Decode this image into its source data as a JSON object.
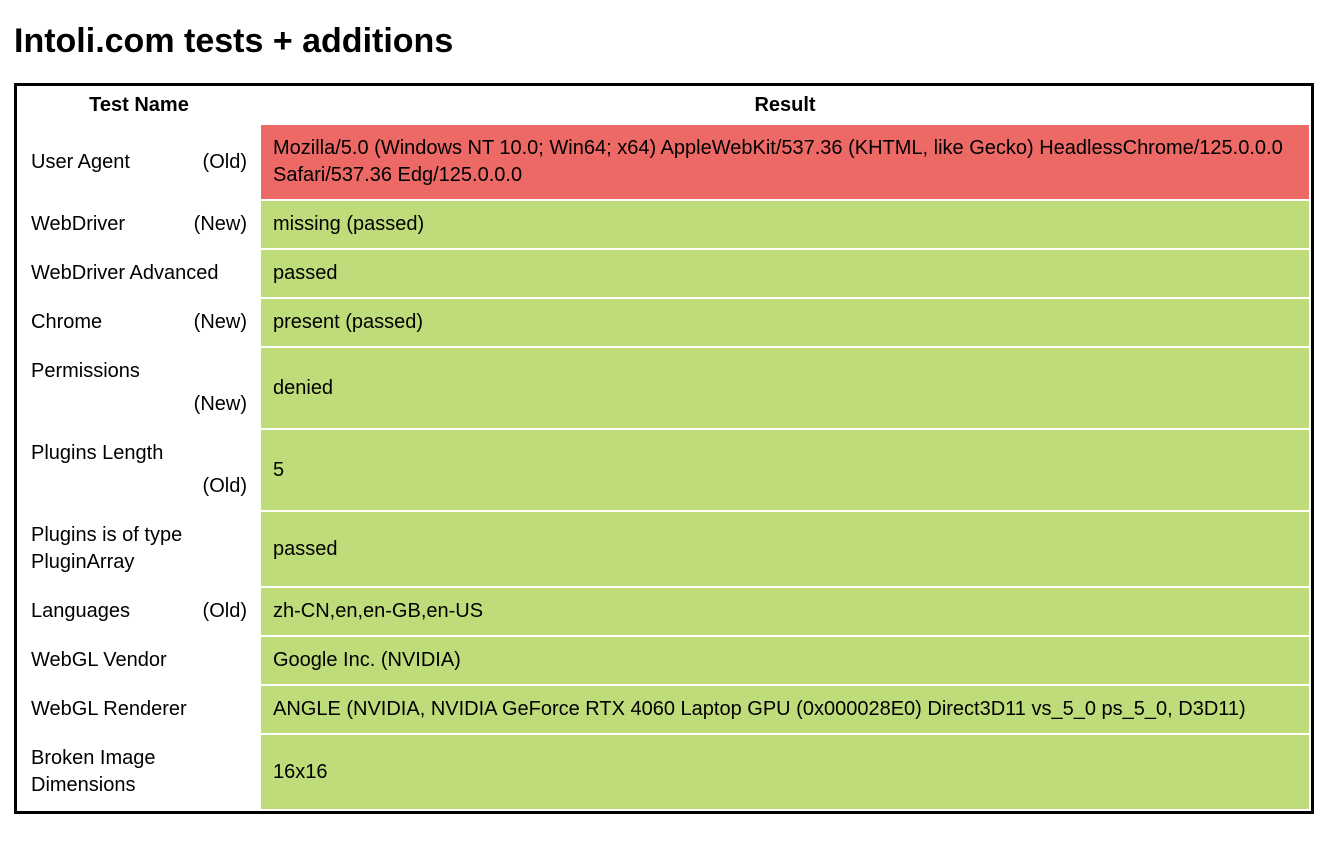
{
  "title": "Intoli.com tests + additions",
  "headers": {
    "name": "Test Name",
    "result": "Result"
  },
  "colors": {
    "pass": "#bfdc7a",
    "fail": "#ec6965"
  },
  "rows": [
    {
      "name": "User Agent",
      "tag": "(Old)",
      "tag_stack": false,
      "status": "fail",
      "result": "Mozilla/5.0 (Windows NT 10.0; Win64; x64) AppleWebKit/537.36 (KHTML, like Gecko) HeadlessChrome/125.0.0.0 Safari/537.36 Edg/125.0.0.0"
    },
    {
      "name": "WebDriver",
      "tag": "(New)",
      "tag_stack": false,
      "status": "pass",
      "result": "missing (passed)"
    },
    {
      "name": "WebDriver Advanced",
      "tag": "",
      "tag_stack": false,
      "status": "pass",
      "result": "passed"
    },
    {
      "name": "Chrome",
      "tag": "(New)",
      "tag_stack": false,
      "status": "pass",
      "result": "present (passed)"
    },
    {
      "name": "Permissions",
      "tag": "(New)",
      "tag_stack": true,
      "status": "pass",
      "result": "denied"
    },
    {
      "name": "Plugins Length",
      "tag": "(Old)",
      "tag_stack": true,
      "status": "pass",
      "result": "5"
    },
    {
      "name": "Plugins is of type PluginArray",
      "tag": "",
      "tag_stack": false,
      "status": "pass",
      "result": "passed"
    },
    {
      "name": "Languages",
      "tag": "(Old)",
      "tag_stack": false,
      "status": "pass",
      "result": "zh-CN,en,en-GB,en-US"
    },
    {
      "name": "WebGL Vendor",
      "tag": "",
      "tag_stack": false,
      "status": "pass",
      "result": "Google Inc. (NVIDIA)"
    },
    {
      "name": "WebGL Renderer",
      "tag": "",
      "tag_stack": false,
      "status": "pass",
      "result": "ANGLE (NVIDIA, NVIDIA GeForce RTX 4060 Laptop GPU (0x000028E0) Direct3D11 vs_5_0 ps_5_0, D3D11)"
    },
    {
      "name": "Broken Image Dimensions",
      "tag": "",
      "tag_stack": false,
      "status": "pass",
      "result": "16x16"
    }
  ]
}
